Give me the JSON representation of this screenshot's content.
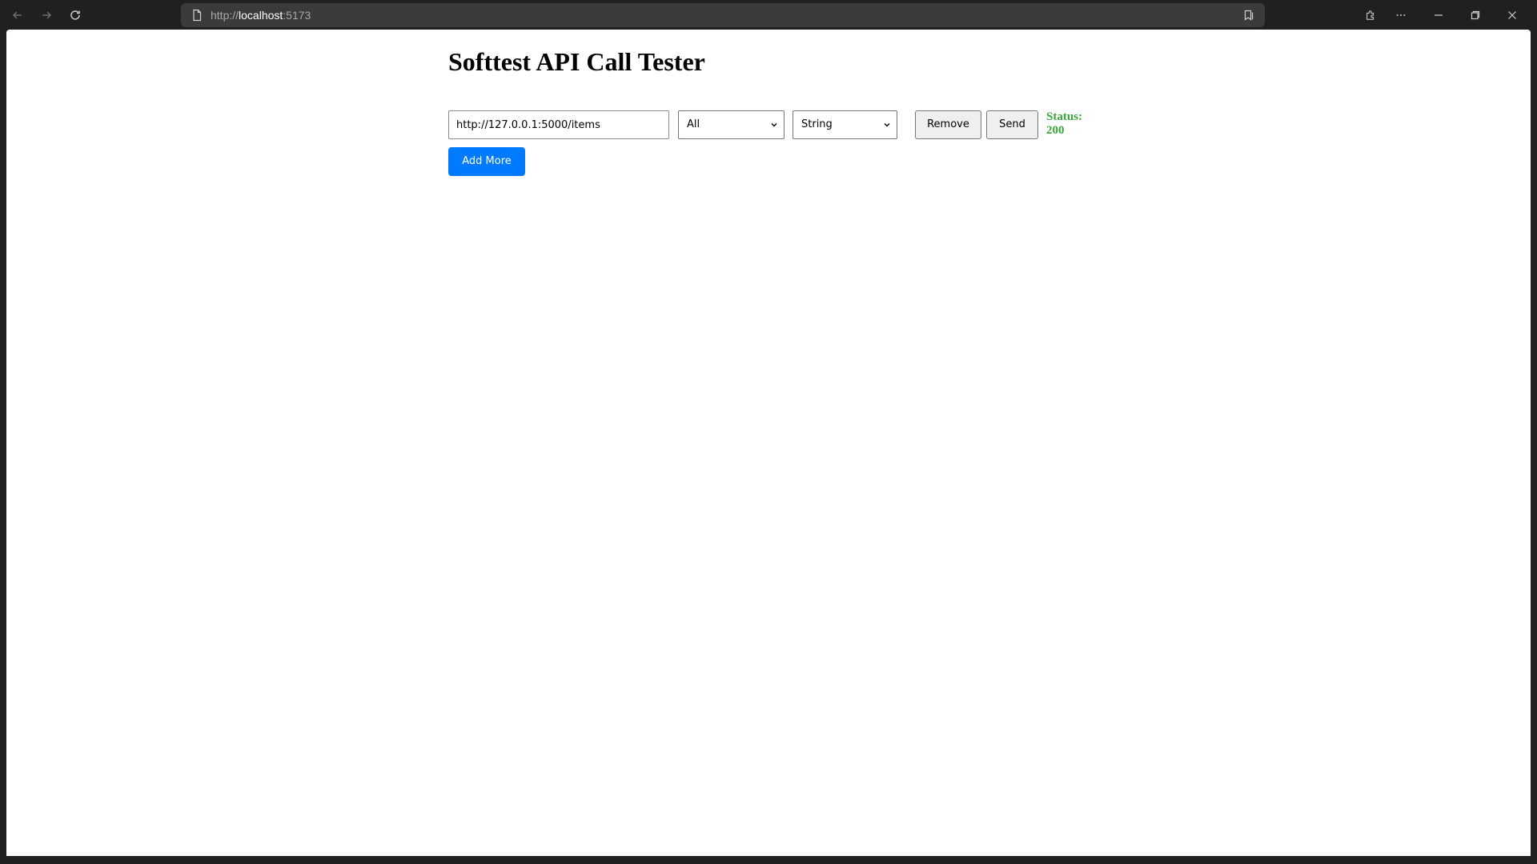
{
  "browser": {
    "url_scheme": "http://",
    "url_host": "localhost",
    "url_port": ":5173"
  },
  "app": {
    "title": "Softtest API Call Tester",
    "request": {
      "url_value": "http://127.0.0.1:5000/items",
      "method_selected": "All",
      "type_selected": "String",
      "remove_label": "Remove",
      "send_label": "Send",
      "status_label": "Status:",
      "status_code": "200"
    },
    "add_more_label": "Add More"
  },
  "colors": {
    "status": "#3aa63a",
    "primary_button": "#007bff"
  }
}
